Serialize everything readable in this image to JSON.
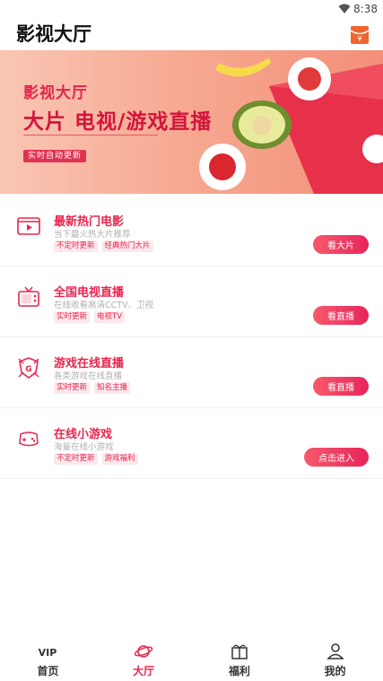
{
  "status": {
    "time": "8:38"
  },
  "header": {
    "title": "影视大厅"
  },
  "banner": {
    "title": "影视大厅",
    "slogan": "大片 电视/游戏直播",
    "tag": "实时自动更新"
  },
  "list": [
    {
      "title": "最新热门电影",
      "subtitle": "当下最火热大片推荐",
      "tags": [
        "不定时更新",
        "经典热门大片"
      ],
      "button": "看大片",
      "icon": "film-icon"
    },
    {
      "title": "全国电视直播",
      "subtitle": "在线收看高清CCTV、卫视",
      "tags": [
        "实时更新",
        "电视TV"
      ],
      "button": "看直播",
      "icon": "tv-icon"
    },
    {
      "title": "游戏在线直播",
      "subtitle": "各类游戏在线直播",
      "tags": [
        "实时更新",
        "知名主播"
      ],
      "button": "看直播",
      "icon": "game-shield-icon"
    },
    {
      "title": "在线小游戏",
      "subtitle": "海量在线小游戏",
      "tags": [
        "不定时更新",
        "游戏福利"
      ],
      "button": "点击进入",
      "icon": "gamepad-icon"
    }
  ],
  "tabs": [
    {
      "label": "首页",
      "icon": "vip-icon",
      "active": false
    },
    {
      "label": "大厅",
      "icon": "planet-icon",
      "active": true
    },
    {
      "label": "福利",
      "icon": "gift-icon",
      "active": false
    },
    {
      "label": "我的",
      "icon": "person-icon",
      "active": false
    }
  ],
  "colors": {
    "accent": "#e8254d",
    "banner": "#f7aa93"
  }
}
